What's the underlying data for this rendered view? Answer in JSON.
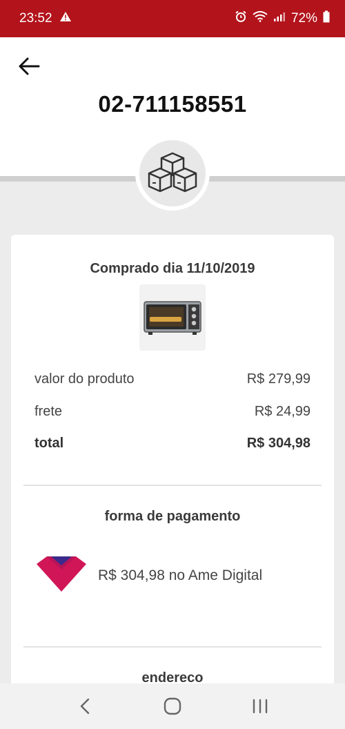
{
  "status_bar": {
    "time": "23:52",
    "battery": "72%",
    "accent": "#b3131b"
  },
  "header": {
    "order_number": "02-711158551",
    "back_icon": "arrow-left-icon",
    "badge_icon": "boxes-icon"
  },
  "order": {
    "purchase_date": "Comprado dia 11/10/2019",
    "product_image": "toaster-oven",
    "rows": [
      {
        "label": "valor do produto",
        "value": "R$ 279,99"
      },
      {
        "label": "frete",
        "value": "R$ 24,99"
      },
      {
        "label": "total",
        "value": "R$ 304,98"
      }
    ]
  },
  "payment": {
    "title": "forma de pagamento",
    "description": "R$ 304,98 no Ame Digital",
    "icon": "ame-heart-icon"
  },
  "address": {
    "title": "endereco"
  },
  "nav": {
    "back": "nav-back-icon",
    "home": "nav-home-icon",
    "recents": "nav-recents-icon"
  }
}
